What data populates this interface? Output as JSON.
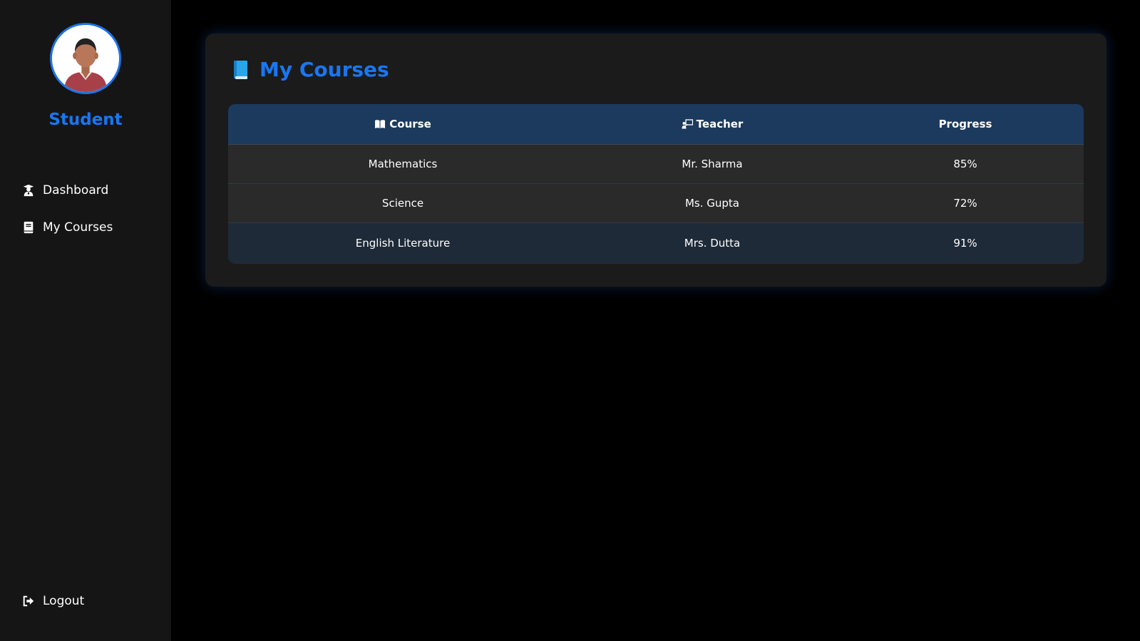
{
  "sidebar": {
    "role": "Student",
    "nav": [
      {
        "label": "Dashboard",
        "icon": "graduate-icon"
      },
      {
        "label": "My Courses",
        "icon": "book-icon"
      }
    ],
    "logout_label": "Logout"
  },
  "courses": {
    "title": "My Courses",
    "columns": [
      {
        "label": "Course",
        "icon": "open-book-icon"
      },
      {
        "label": "Teacher",
        "icon": "teacher-icon"
      },
      {
        "label": "Progress"
      }
    ],
    "rows": [
      {
        "course": "Mathematics",
        "teacher": "Mr. Sharma",
        "progress": "85%"
      },
      {
        "course": "Science",
        "teacher": "Ms. Gupta",
        "progress": "72%"
      },
      {
        "course": "English Literature",
        "teacher": "Mrs. Dutta",
        "progress": "91%"
      }
    ]
  },
  "colors": {
    "accent": "#1877f2",
    "sidebar_bg": "#151515",
    "card_bg": "#1b1b1b",
    "table_header_bg": "#1c3a5e"
  }
}
